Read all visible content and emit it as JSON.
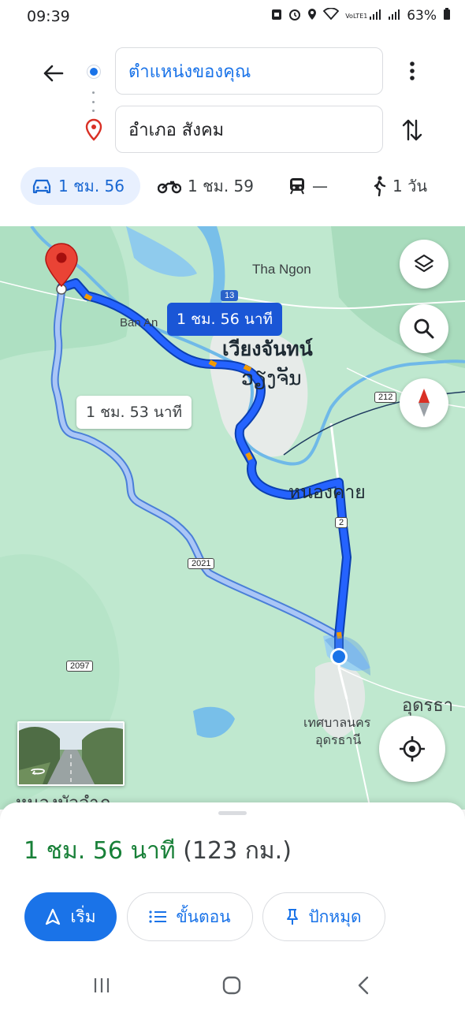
{
  "status_bar": {
    "time": "09:39",
    "lte_label": "VoLTE1",
    "battery": "63%",
    "icons": [
      "tray-icon",
      "alarm-icon",
      "location-icon",
      "wifi-icon",
      "lte-icon",
      "signal-icon",
      "signal-icon",
      "battery-icon"
    ]
  },
  "directions": {
    "origin": "ตำแหน่งของคุณ",
    "destination": "อำเภอ สังคม",
    "modes": [
      {
        "icon": "car-icon",
        "label": "1 ชม. 56",
        "active": true
      },
      {
        "icon": "motorcycle-icon",
        "label": "1 ชม. 59",
        "active": false
      },
      {
        "icon": "transit-icon",
        "label": "—",
        "active": false
      },
      {
        "icon": "walk-icon",
        "label": "1 วัน",
        "active": false
      }
    ]
  },
  "map": {
    "labels": {
      "tha_ngon": "Tha Ngon",
      "ban_an": "Ban An",
      "vientiane": "เวียงจันทน์",
      "vientiane_sub": "ວຽງຈັນ",
      "nong_khai": "หนองคาย",
      "udon": "อุดรธา",
      "udon_muni_1": "เทศบาลนคร",
      "udon_muni_2": "อุดรธานี",
      "bottom_clip": "หนองบัวลำภู"
    },
    "shields": {
      "r13": "13",
      "r212": "212",
      "r2": "2",
      "r2021": "2021",
      "r2097": "2097"
    },
    "route_primary_label": "1 ชม. 56 นาที",
    "route_alt_label": "1 ชม. 53 นาที",
    "colors": {
      "route_primary": "#1a56d6",
      "route_alt": "#8ab4f8",
      "water": "#5fb4e6",
      "land": "#bfe8cf",
      "destination_pin": "#ea4335"
    }
  },
  "summary": {
    "duration": "1 ชม. 56 นาที",
    "distance": "(123 กม.)"
  },
  "actions": {
    "start": "เริ่ม",
    "steps": "ขั้นตอน",
    "pin": "ปักหมุด"
  },
  "nav_icons": [
    "recents-icon",
    "home-icon",
    "back-icon"
  ]
}
